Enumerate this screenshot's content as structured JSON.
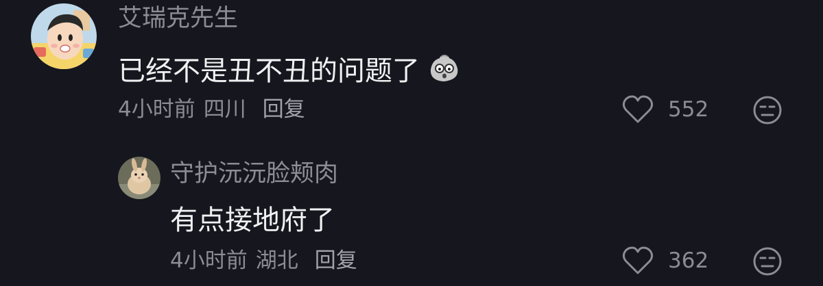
{
  "comments": [
    {
      "username": "艾瑞克先生",
      "content": "已经不是丑不丑的问题了",
      "time": "4小时前",
      "location": "四川",
      "reply_label": "回复",
      "likes": "552",
      "avatar_icon": "cartoon-boy-avatar",
      "inline_emoji": "shocked-potato-emoji"
    },
    {
      "username": "守护沅沅脸颊肉",
      "content": "有点接地府了",
      "time": "4小时前",
      "location": "湖北",
      "reply_label": "回复",
      "likes": "362",
      "avatar_icon": "rabbit-photo-avatar"
    }
  ],
  "colors": {
    "background": "#16161e",
    "username": "#8c8c93",
    "content": "#f1f1f3",
    "meta": "#8c8c93",
    "icon": "#8c8c93"
  }
}
